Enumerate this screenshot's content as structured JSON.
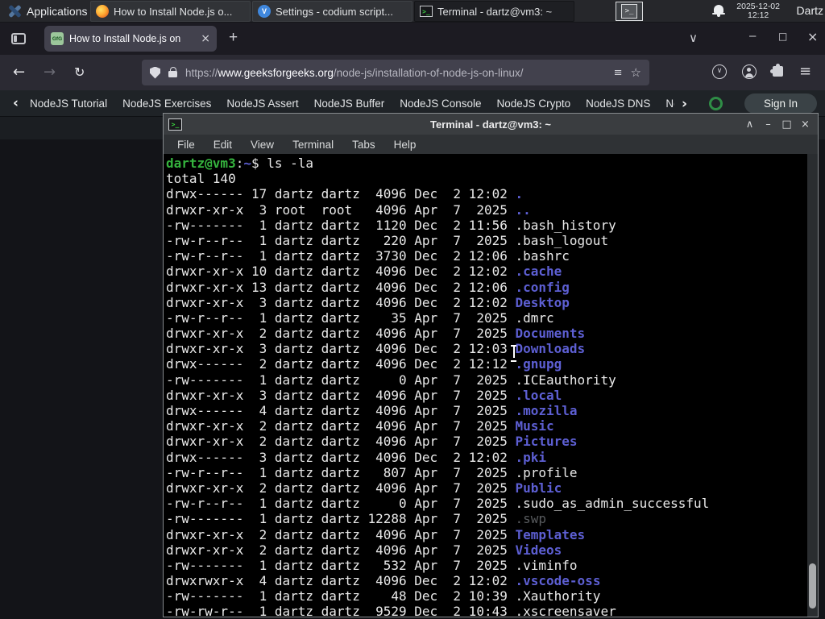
{
  "panel": {
    "applications_label": "Applications",
    "windows": [
      {
        "title": "How to Install Node.js o...",
        "icon": "firefox",
        "active": false
      },
      {
        "title": "Settings - codium script...",
        "icon": "codium",
        "active": false
      },
      {
        "title": "Terminal - dartz@vm3: ~",
        "icon": "terminal",
        "active": true
      }
    ],
    "clock_date": "2025-12-02",
    "clock_time": "12:12",
    "user": "Dartz"
  },
  "browser": {
    "tab": {
      "title": "How to Install Node.js on",
      "favicon_glyph": "GfG"
    },
    "url_protocol": "https://",
    "url_domain": "www.geeksforgeeks.org",
    "url_path": "/node-js/installation-of-node-js-on-linux/"
  },
  "site_nav": {
    "links": [
      "NodeJS Tutorial",
      "NodeJS Exercises",
      "NodeJS Assert",
      "NodeJS Buffer",
      "NodeJS Console",
      "NodeJS Crypto",
      "NodeJS DNS",
      "Node"
    ],
    "sign_in_label": "Sign In"
  },
  "icons": {
    "back": "←",
    "forward": "→",
    "reload": "↻",
    "tab_list": "∨",
    "new_tab": "+",
    "minimize": "–",
    "maximize": "□",
    "close": "×",
    "shade": "∧",
    "close_tab": "×",
    "menu": "≡",
    "star": "☆",
    "reader": "≡",
    "pocket": "∨",
    "prev": "‹",
    "next": "›",
    "terminal_glyph": ">_",
    "codium_glyph": "V",
    "grip": "≡"
  },
  "colors": {
    "gfg_green": "#2f8d46",
    "dir_blue": "#5d5fd3",
    "prompt_green": "#35b33e",
    "firefox_orange": "#ffab33",
    "panel_bg": "#26272b",
    "terminal_bg": "#000000"
  },
  "terminal": {
    "title": "Terminal - dartz@vm3: ~",
    "menu": [
      "File",
      "Edit",
      "View",
      "Terminal",
      "Tabs",
      "Help"
    ],
    "lines": [
      [
        [
          "dartz@vm3",
          "g"
        ],
        [
          ":",
          "w"
        ],
        [
          "~",
          "b"
        ],
        [
          "$ ls -la",
          "w"
        ]
      ],
      [
        [
          "total 140",
          "w"
        ]
      ],
      [
        [
          "drwx------ 17 dartz dartz  4096 Dec  2 12:02 ",
          "w"
        ],
        [
          ".",
          "b"
        ]
      ],
      [
        [
          "drwxr-xr-x  3 root  root   4096 Apr  7  2025 ",
          "w"
        ],
        [
          "..",
          "b"
        ]
      ],
      [
        [
          "-rw-------  1 dartz dartz  1120 Dec  2 11:56 .bash_history",
          "w"
        ]
      ],
      [
        [
          "-rw-r--r--  1 dartz dartz   220 Apr  7  2025 .bash_logout",
          "w"
        ]
      ],
      [
        [
          "-rw-r--r--  1 dartz dartz  3730 Dec  2 12:06 .bashrc",
          "w"
        ]
      ],
      [
        [
          "drwxr-xr-x 10 dartz dartz  4096 Dec  2 12:02 ",
          "w"
        ],
        [
          ".cache",
          "b"
        ]
      ],
      [
        [
          "drwxr-xr-x 13 dartz dartz  4096 Dec  2 12:06 ",
          "w"
        ],
        [
          ".config",
          "b"
        ]
      ],
      [
        [
          "drwxr-xr-x  3 dartz dartz  4096 Dec  2 12:02 ",
          "w"
        ],
        [
          "Desktop",
          "b"
        ]
      ],
      [
        [
          "-rw-r--r--  1 dartz dartz    35 Apr  7  2025 .dmrc",
          "w"
        ]
      ],
      [
        [
          "drwxr-xr-x  2 dartz dartz  4096 Apr  7  2025 ",
          "w"
        ],
        [
          "Documents",
          "b"
        ]
      ],
      [
        [
          "drwxr-xr-x  3 dartz dartz  4096 Dec  2 12:03 ",
          "w"
        ],
        [
          "Downloads",
          "b"
        ]
      ],
      [
        [
          "drwx------  2 dartz dartz  4096 Dec  2 12:12 ",
          "w"
        ],
        [
          ".gnupg",
          "b"
        ]
      ],
      [
        [
          "-rw-------  1 dartz dartz     0 Apr  7  2025 .ICEauthority",
          "w"
        ]
      ],
      [
        [
          "drwxr-xr-x  3 dartz dartz  4096 Apr  7  2025 ",
          "w"
        ],
        [
          ".local",
          "b"
        ]
      ],
      [
        [
          "drwx------  4 dartz dartz  4096 Apr  7  2025 ",
          "w"
        ],
        [
          ".mozilla",
          "b"
        ]
      ],
      [
        [
          "drwxr-xr-x  2 dartz dartz  4096 Apr  7  2025 ",
          "w"
        ],
        [
          "Music",
          "b"
        ]
      ],
      [
        [
          "drwxr-xr-x  2 dartz dartz  4096 Apr  7  2025 ",
          "w"
        ],
        [
          "Pictures",
          "b"
        ]
      ],
      [
        [
          "drwx------  3 dartz dartz  4096 Dec  2 12:02 ",
          "w"
        ],
        [
          ".pki",
          "b"
        ]
      ],
      [
        [
          "-rw-r--r--  1 dartz dartz   807 Apr  7  2025 .profile",
          "w"
        ]
      ],
      [
        [
          "drwxr-xr-x  2 dartz dartz  4096 Apr  7  2025 ",
          "w"
        ],
        [
          "Public",
          "b"
        ]
      ],
      [
        [
          "-rw-r--r--  1 dartz dartz     0 Apr  7  2025 .sudo_as_admin_successful",
          "w"
        ]
      ],
      [
        [
          "-rw-------  1 dartz dartz 12288 Apr  7  2025 ",
          "w"
        ],
        [
          ".swp",
          "d"
        ]
      ],
      [
        [
          "drwxr-xr-x  2 dartz dartz  4096 Apr  7  2025 ",
          "w"
        ],
        [
          "Templates",
          "b"
        ]
      ],
      [
        [
          "drwxr-xr-x  2 dartz dartz  4096 Apr  7  2025 ",
          "w"
        ],
        [
          "Videos",
          "b"
        ]
      ],
      [
        [
          "-rw-------  1 dartz dartz   532 Apr  7  2025 .viminfo",
          "w"
        ]
      ],
      [
        [
          "drwxrwxr-x  4 dartz dartz  4096 Dec  2 12:02 ",
          "w"
        ],
        [
          ".vscode-oss",
          "b"
        ]
      ],
      [
        [
          "-rw-------  1 dartz dartz    48 Dec  2 10:39 .Xauthority",
          "w"
        ]
      ],
      [
        [
          "-rw-rw-r--  1 dartz dartz  9529 Dec  2 10:43 .xscreensaver",
          "w"
        ]
      ]
    ]
  }
}
